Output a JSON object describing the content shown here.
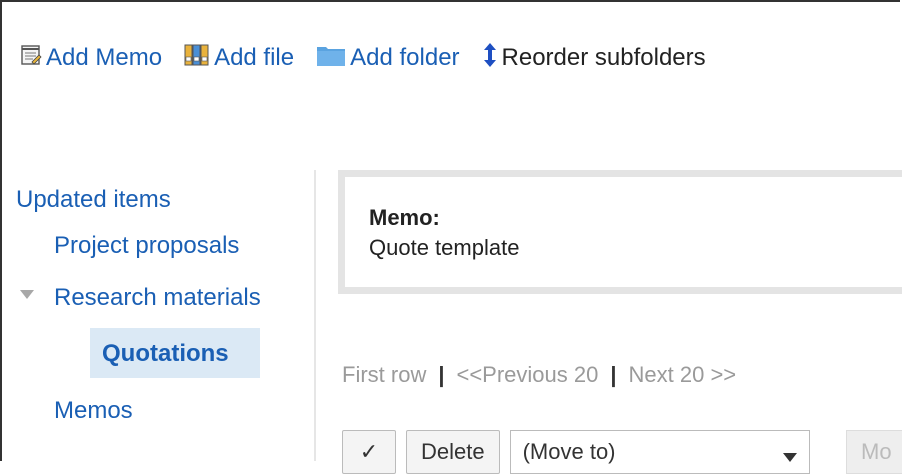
{
  "toolbar": {
    "add_memo": {
      "label": "Add Memo",
      "icon": "memo-icon"
    },
    "add_file": {
      "label": "Add file",
      "icon": "file-icon"
    },
    "add_folder": {
      "label": "Add folder",
      "icon": "folder-icon"
    },
    "reorder": {
      "label": "Reorder subfolders",
      "icon": "reorder-icon"
    }
  },
  "sidebar": {
    "items": [
      {
        "label": "Updated items"
      },
      {
        "label": "Project proposals"
      },
      {
        "label": "Research materials"
      },
      {
        "label": "Quotations",
        "selected": true
      },
      {
        "label": "Memos"
      }
    ]
  },
  "memo": {
    "label": "Memo:",
    "value": "Quote template"
  },
  "pager": {
    "first": "First row",
    "sep1": "|",
    "prev": "<<Previous 20",
    "sep2": "|",
    "next": "Next 20 >>"
  },
  "actions": {
    "check": "✓",
    "delete": "Delete",
    "move_to": "(Move to)",
    "move": "Mo"
  },
  "colors": {
    "link": "#1a5fb4",
    "selected_bg": "#dbe9f5",
    "memo_border": "#e4e4e4",
    "muted": "#9a9a9a"
  }
}
